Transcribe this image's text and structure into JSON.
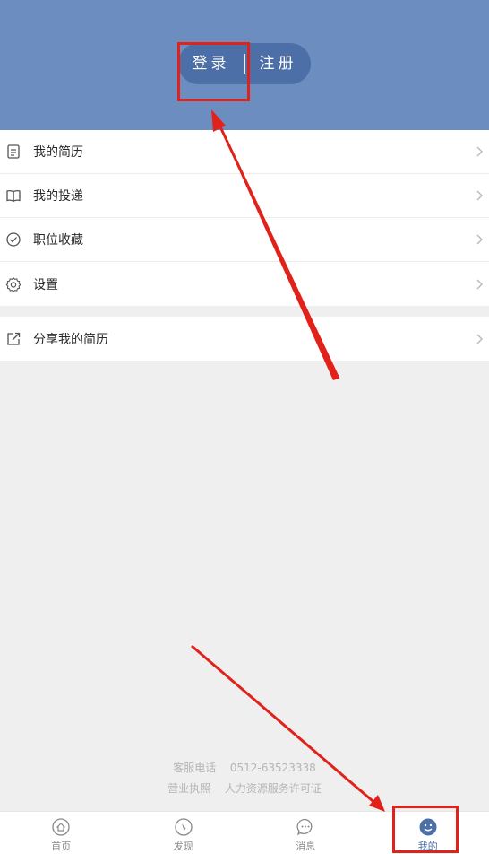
{
  "header": {
    "login_label": "登录",
    "register_label": "注册",
    "color": "#6c8dbf"
  },
  "menu": {
    "items": [
      {
        "label": "我的简历",
        "icon": "document-icon"
      },
      {
        "label": "我的投递",
        "icon": "book-icon"
      },
      {
        "label": "职位收藏",
        "icon": "check-circle-icon"
      },
      {
        "label": "设置",
        "icon": "gear-icon"
      }
    ]
  },
  "menu2": {
    "items": [
      {
        "label": "分享我的简历",
        "icon": "share-icon"
      }
    ]
  },
  "footer": {
    "phone_label": "客服电话",
    "phone_number": "0512-63523338",
    "license_label": "营业执照",
    "hr_license_label": "人力资源服务许可证"
  },
  "tabbar": {
    "tabs": [
      {
        "label": "首页",
        "icon": "home-icon",
        "active": false
      },
      {
        "label": "发现",
        "icon": "compass-icon",
        "active": false
      },
      {
        "label": "消息",
        "icon": "message-icon",
        "active": false
      },
      {
        "label": "我的",
        "icon": "smiley-icon",
        "active": true
      }
    ],
    "active_color": "#4d6fa7"
  },
  "annotation_color": "#e0221b"
}
